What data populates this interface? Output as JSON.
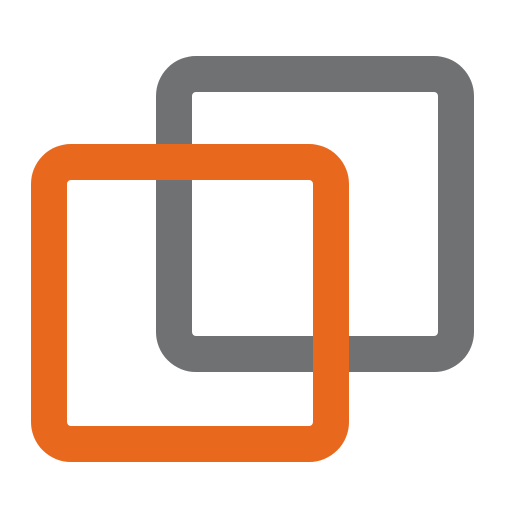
{
  "icon": {
    "name": "overlapping-squares-icon",
    "colors": {
      "back_square": "#707173",
      "front_square": "#E8691E",
      "background": "#FFFFFF"
    }
  }
}
